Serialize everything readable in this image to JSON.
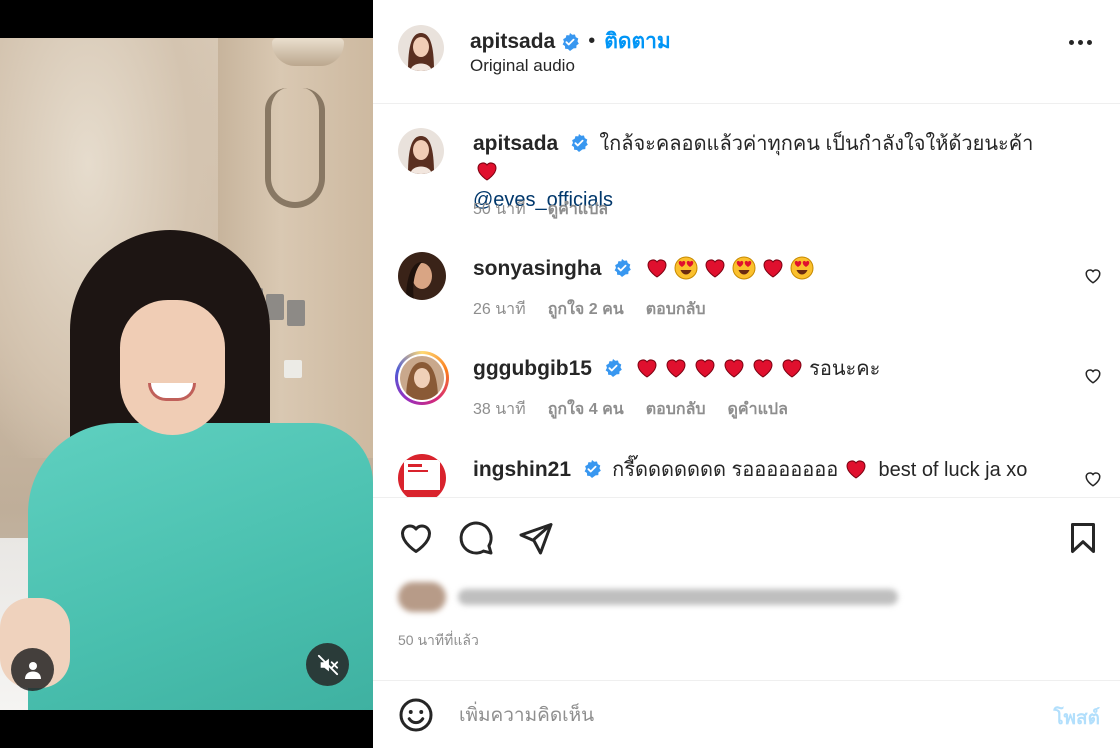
{
  "header": {
    "username": "apitsada",
    "separator": "•",
    "follow_label": "ติดตาม",
    "audio_label": "Original audio"
  },
  "caption": {
    "username": "apitsada",
    "text": "ใกล้จะคลอดแล้วค่าทุกคน เป็นกำลังใจให้ด้วยนะค้า",
    "mention": "@eves_officials",
    "time": "50 นาที",
    "translate": "ดูคำแปล"
  },
  "comments": [
    {
      "username": "sonyasingha",
      "emojis": [
        "heart",
        "heart-eyes",
        "heart",
        "heart-eyes",
        "heart",
        "heart-eyes"
      ],
      "text": "",
      "time": "26 นาที",
      "likes": "ถูกใจ 2 คน",
      "reply": "ตอบกลับ"
    },
    {
      "username": "gggubgib15",
      "emojis": [
        "heart",
        "heart",
        "heart",
        "heart",
        "heart",
        "heart"
      ],
      "text": "รอนะคะ",
      "time": "38 นาที",
      "likes": "ถูกใจ 4 คน",
      "reply": "ตอบกลับ",
      "translate": "ดูคำแปล"
    },
    {
      "username": "ingshin21",
      "text_before": "กรี๊ดดดดดดด รออออออออ",
      "text_after": "best of luck ja xo"
    }
  ],
  "footer": {
    "time_ago": "50 นาทีที่แล้ว",
    "comment_placeholder": "เพิ่มความคิดเห็น",
    "post_label": "โพสต์"
  },
  "colors": {
    "follow_blue": "#0095f6",
    "verified_blue": "#3897f0",
    "heart_red": "#e0102e",
    "post_disabled": "#b2dffc",
    "scrub_green": "#4fc4b3"
  }
}
